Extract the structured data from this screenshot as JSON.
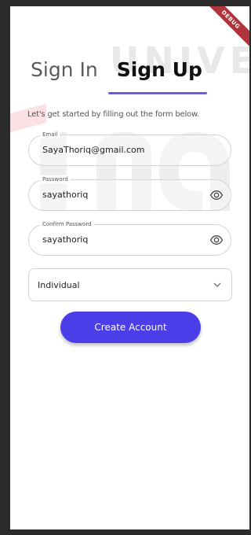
{
  "watermark": {
    "text": "UNIVER"
  },
  "debug_banner": {
    "label": "DEBUG"
  },
  "tabs": [
    {
      "label": "Sign In",
      "active": false
    },
    {
      "label": "Sign Up",
      "active": true
    }
  ],
  "subtitle": "Let's get started by filling out the form below.",
  "form": {
    "email": {
      "label": "Email",
      "value": "SayaThoriq@gmail.com"
    },
    "password": {
      "label": "Password",
      "value": "sayathoriq",
      "icon": "eye-icon"
    },
    "confirm_password": {
      "label": "Confirm Password",
      "value": "sayathoriq",
      "icon": "eye-icon"
    },
    "account_type": {
      "selected": "Individual",
      "icon": "chevron-down-icon"
    }
  },
  "create_button": {
    "label": "Create Account"
  },
  "colors": {
    "accent": "#4b3de8",
    "tab_underline": "#6a5fe0",
    "debug_banner": "#b0343c",
    "watermark_red": "#e85a62"
  }
}
